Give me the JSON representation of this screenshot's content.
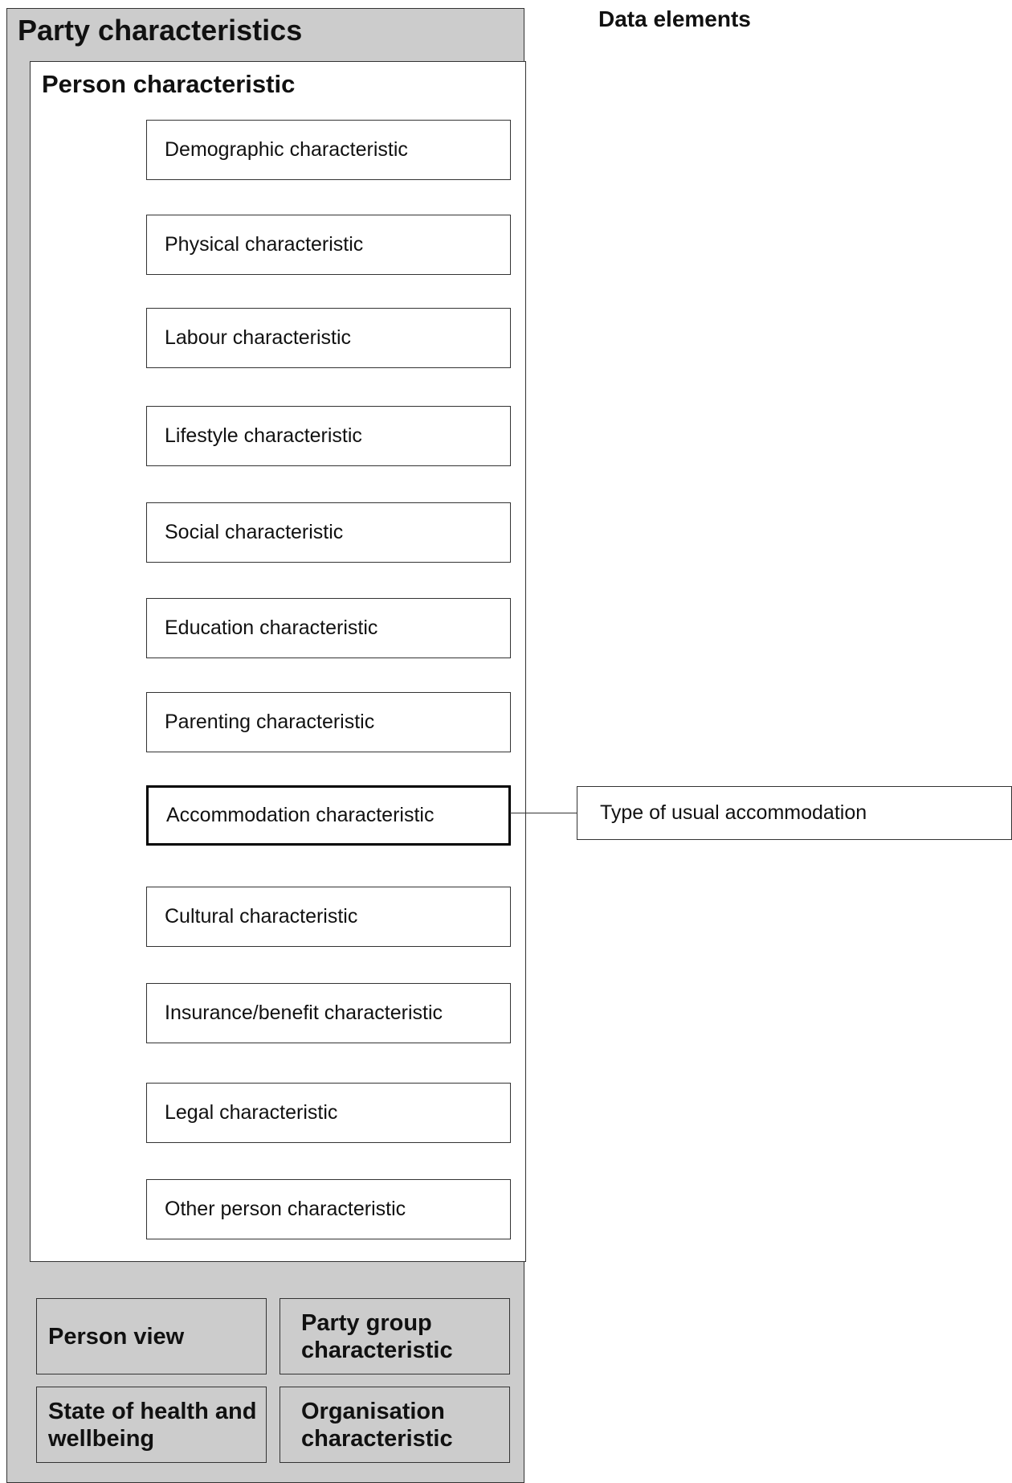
{
  "outer_title": "Party characteristics",
  "person_title": "Person characteristic",
  "characteristics": [
    "Demographic characteristic",
    "Physical characteristic",
    "Labour characteristic",
    "Lifestyle characteristic",
    "Social characteristic",
    "Education characteristic",
    "Parenting characteristic",
    "Accommodation characteristic",
    "Cultural characteristic",
    "Insurance/benefit characteristic",
    "Legal characteristic",
    "Other person characteristic"
  ],
  "selected_characteristic": "Accommodation characteristic",
  "bottom_boxes": {
    "person_view": "Person view",
    "party_group": "Party group characteristic",
    "state_of_health": "State of health and wellbeing",
    "organisation": "Organisation characteristic"
  },
  "data_elements_title": "Data elements",
  "data_elements": [
    "Type of usual accommodation"
  ]
}
